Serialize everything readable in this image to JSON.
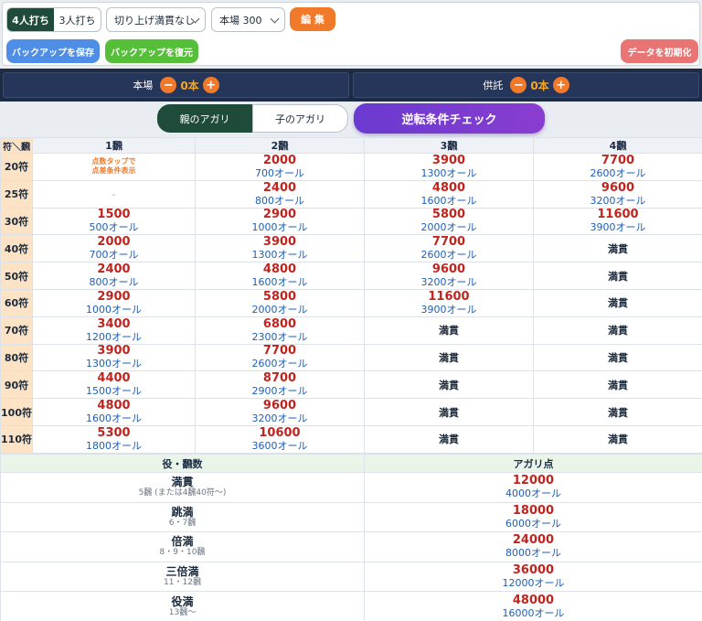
{
  "controls": {
    "player_mode": {
      "options": [
        "4人打ち",
        "3人打ち"
      ],
      "selected": 0
    },
    "kiriage_select": "切り上げ満貫なし",
    "honba_select": "本場 300",
    "edit_button": "編 集",
    "save_button": "バックアップを保存",
    "restore_button": "バックアップを復元",
    "init_button": "データを初期化"
  },
  "counters": {
    "honba": {
      "label": "本場",
      "value": "0本",
      "minus": "−",
      "plus": "+"
    },
    "kyotaku": {
      "label": "供託",
      "value": "0本",
      "minus": "−",
      "plus": "+"
    }
  },
  "tabs": {
    "parent": "親のアガリ",
    "child": "子のアガリ",
    "check": "逆転条件チェック",
    "active": "parent"
  },
  "score_table": {
    "corner": "符＼飜",
    "columns": [
      "1飜",
      "2飜",
      "3飜",
      "4飜"
    ],
    "hint_lines": [
      "点数タップで",
      "点差条件表示"
    ],
    "rows": [
      {
        "fu": "20符",
        "cells": [
          {
            "hint": true
          },
          {
            "p": "2000",
            "a": "700オール"
          },
          {
            "p": "3900",
            "a": "1300オール"
          },
          {
            "p": "7700",
            "a": "2600オール"
          }
        ]
      },
      {
        "fu": "25符",
        "cells": [
          {
            "dash": "-"
          },
          {
            "p": "2400",
            "a": "800オール"
          },
          {
            "p": "4800",
            "a": "1600オール"
          },
          {
            "p": "9600",
            "a": "3200オール"
          }
        ]
      },
      {
        "fu": "30符",
        "cells": [
          {
            "p": "1500",
            "a": "500オール"
          },
          {
            "p": "2900",
            "a": "1000オール"
          },
          {
            "p": "5800",
            "a": "2000オール"
          },
          {
            "p": "11600",
            "a": "3900オール"
          }
        ]
      },
      {
        "fu": "40符",
        "cells": [
          {
            "p": "2000",
            "a": "700オール"
          },
          {
            "p": "3900",
            "a": "1300オール"
          },
          {
            "p": "7700",
            "a": "2600オール"
          },
          {
            "m": "満貫"
          }
        ]
      },
      {
        "fu": "50符",
        "cells": [
          {
            "p": "2400",
            "a": "800オール"
          },
          {
            "p": "4800",
            "a": "1600オール"
          },
          {
            "p": "9600",
            "a": "3200オール"
          },
          {
            "m": "満貫"
          }
        ]
      },
      {
        "fu": "60符",
        "cells": [
          {
            "p": "2900",
            "a": "1000オール"
          },
          {
            "p": "5800",
            "a": "2000オール"
          },
          {
            "p": "11600",
            "a": "3900オール"
          },
          {
            "m": "満貫"
          }
        ]
      },
      {
        "fu": "70符",
        "cells": [
          {
            "p": "3400",
            "a": "1200オール"
          },
          {
            "p": "6800",
            "a": "2300オール"
          },
          {
            "m": "満貫"
          },
          {
            "m": "満貫"
          }
        ]
      },
      {
        "fu": "80符",
        "cells": [
          {
            "p": "3900",
            "a": "1300オール"
          },
          {
            "p": "7700",
            "a": "2600オール"
          },
          {
            "m": "満貫"
          },
          {
            "m": "満貫"
          }
        ]
      },
      {
        "fu": "90符",
        "cells": [
          {
            "p": "4400",
            "a": "1500オール"
          },
          {
            "p": "8700",
            "a": "2900オール"
          },
          {
            "m": "満貫"
          },
          {
            "m": "満貫"
          }
        ]
      },
      {
        "fu": "100符",
        "cells": [
          {
            "p": "4800",
            "a": "1600オール"
          },
          {
            "p": "9600",
            "a": "3200オール"
          },
          {
            "m": "満貫"
          },
          {
            "m": "満貫"
          }
        ]
      },
      {
        "fu": "110符",
        "cells": [
          {
            "p": "5300",
            "a": "1800オール"
          },
          {
            "p": "10600",
            "a": "3600オール"
          },
          {
            "m": "満貫"
          },
          {
            "m": "満貫"
          }
        ]
      }
    ]
  },
  "limit_table": {
    "headers": [
      "役・飜数",
      "アガリ点"
    ],
    "rows": [
      {
        "name": "満貫",
        "han": "5飜 (または4飜40符〜)",
        "p": "12000",
        "a": "4000オール"
      },
      {
        "name": "跳満",
        "han": "6・7飜",
        "p": "18000",
        "a": "6000オール"
      },
      {
        "name": "倍満",
        "han": "8・9・10飜",
        "p": "24000",
        "a": "8000オール"
      },
      {
        "name": "三倍満",
        "han": "11・12飜",
        "p": "36000",
        "a": "12000オール"
      },
      {
        "name": "役満",
        "han": "13飜〜",
        "p": "48000",
        "a": "16000オール"
      }
    ]
  },
  "colors": {
    "accent_green": "#1f4b3a",
    "accent_orange": "#f17a2a",
    "points_red": "#c0241f",
    "all_blue": "#1e5fb5",
    "check_purple": "#7a3bd0"
  }
}
